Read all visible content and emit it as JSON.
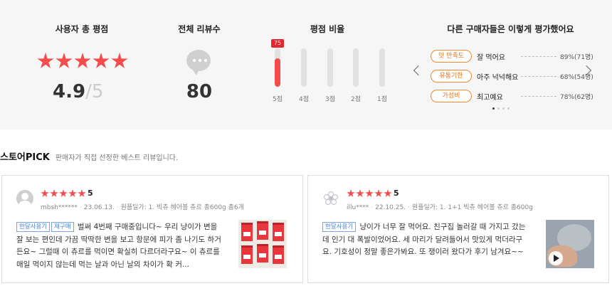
{
  "summary": {
    "rating": {
      "title": "사용자 총 평점",
      "score": "4.9",
      "separator": "/",
      "max": "5",
      "stars": 5
    },
    "total": {
      "title": "전체 리뷰수",
      "count": "80"
    },
    "distribution": {
      "title": "평점 비율",
      "items": [
        {
          "label": "5점",
          "percent": 75,
          "badge": "75"
        },
        {
          "label": "4점",
          "percent": 0
        },
        {
          "label": "3점",
          "percent": 0
        },
        {
          "label": "2점",
          "percent": 0
        },
        {
          "label": "1점",
          "percent": 0
        }
      ]
    },
    "others": {
      "title": "다른 구매자들은 이렇게 평가했어요",
      "rows": [
        {
          "tag": "맛 만족도",
          "text": "잘 먹어요",
          "pct": "89%(71명)"
        },
        {
          "tag": "유통기한",
          "text": "아주 넉넉해요",
          "pct": "68%(54명)"
        },
        {
          "tag": "가성비",
          "text": "최고예요",
          "pct": "78%(62명)"
        }
      ],
      "page_count": 4,
      "active_page": 0
    }
  },
  "pick": {
    "title": "스토어PICK",
    "subtitle": "판매자가 직접 선정한 베스트 리뷰입니다."
  },
  "reviews": [
    {
      "rating": "5",
      "user": "mbsh******",
      "date": "23.06.13.",
      "option": "원플딜가: 1. 빅츄 헤어볼 츄르 총600g 총6개",
      "tags": [
        "한달사용기",
        "재구매"
      ],
      "text": "벌써 4번째 구매중입니다~ 우리 냥이가 변을 잘 보는 편인데 가끔 딱딱한 변을 보고 항문에 피가 좀 나기도 하거든요~ 그럴때 이 츄르를 먹이면 확실히 다르더라구요~ 이 츄르를 매일 먹이지 않는데 먹는 날과 아닌 날의 차이가 확 커..."
    },
    {
      "rating": "5",
      "user": "illu****",
      "date": "22.10.25.",
      "option": "원플딜가: 1. 1+1 빅츄 헤어볼 츄르 총600g",
      "tags": [
        "한달사용기"
      ],
      "text": "냥이가 너무 잘 먹어요. 친구집 놀러갈 때 가지고 갔는데 인기 대 폭발이었어요. 세 마리가 달려들어서 맛있게 먹더라구요. 기호성이 정말 좋은가봐요. 또 쟁이러 왔다가 후기 남겨요~~"
    }
  ],
  "colors": {
    "accent": "#f34c4c",
    "badge": "#e8252d",
    "tag_orange": "#e9731c",
    "tag_blue": "#4a7fd4"
  }
}
